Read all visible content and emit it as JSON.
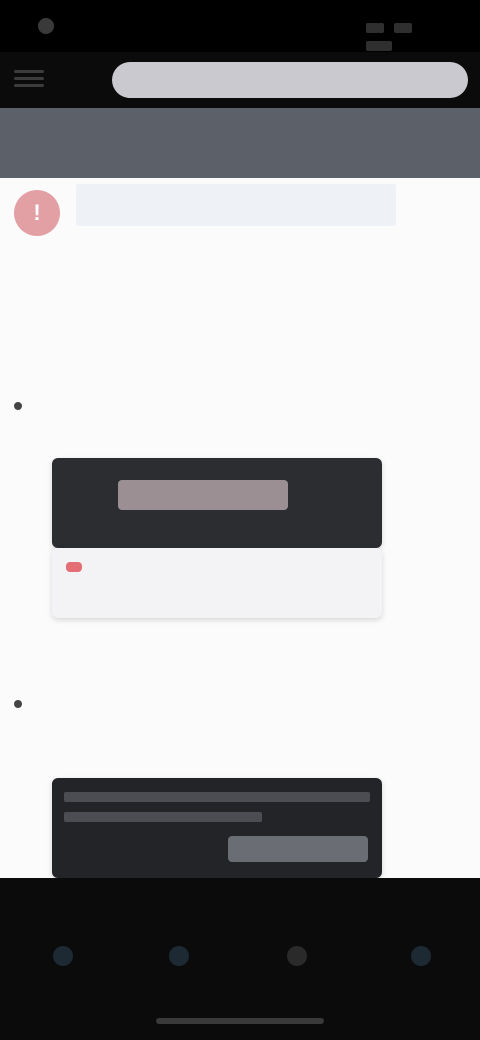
{
  "browser": {
    "url_placeholder": ""
  },
  "article": {
    "title": "",
    "intro_lines": [
      "",
      "",
      ""
    ],
    "steps": [
      {
        "text": ""
      },
      {
        "text": ""
      }
    ]
  },
  "bottom_nav": {
    "items": [
      {
        "icon": "home-icon"
      },
      {
        "icon": "search-icon"
      },
      {
        "icon": "bookmark-icon"
      },
      {
        "icon": "profile-icon"
      }
    ]
  },
  "colors": {
    "title_band": "#5c6169",
    "alert": "#e3a0a4",
    "accent_red": "#e36e73"
  }
}
